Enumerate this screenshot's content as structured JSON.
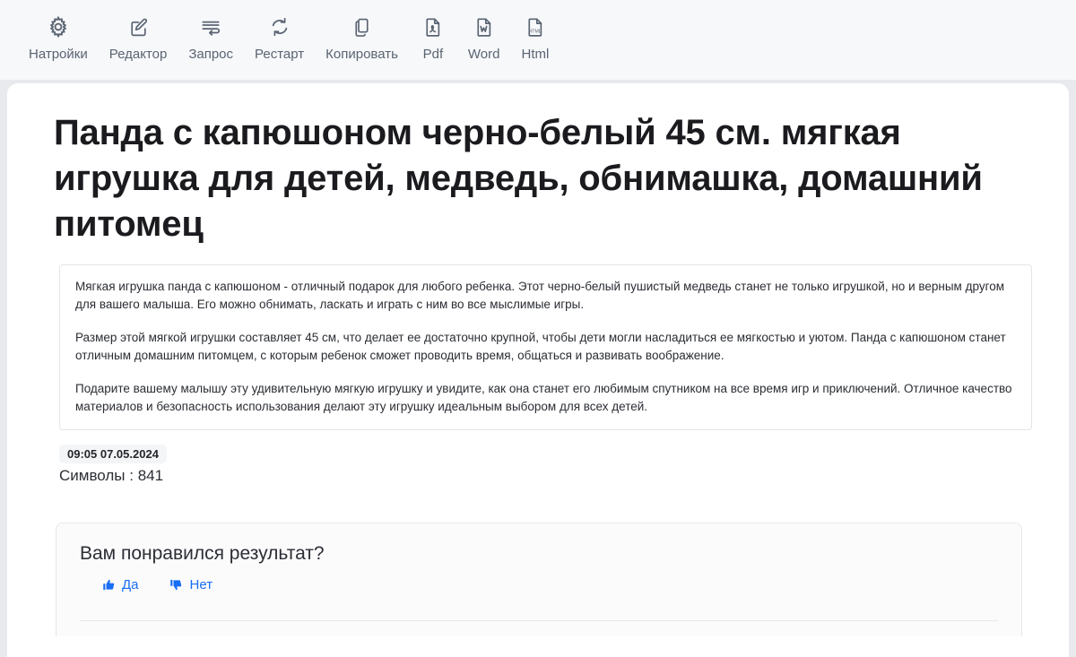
{
  "toolbar": {
    "items": [
      {
        "label": "Натройки",
        "icon": "gear-icon"
      },
      {
        "label": "Редактор",
        "icon": "pencil-edit-icon"
      },
      {
        "label": "Запрос",
        "icon": "request-lines-icon"
      },
      {
        "label": "Рестарт",
        "icon": "refresh-circular-icon"
      },
      {
        "label": "Копировать",
        "icon": "copy-icon"
      },
      {
        "label": "Pdf",
        "icon": "pdf-file-icon"
      },
      {
        "label": "Word",
        "icon": "word-file-icon"
      },
      {
        "label": "Html",
        "icon": "html-file-icon"
      }
    ]
  },
  "content": {
    "title": "Панда с капюшоном черно-белый 45 см. мягкая игрушка для детей, медведь, обнимашка, домашний питомец",
    "paragraphs": [
      "Мягкая игрушка панда с капюшоном - отличный подарок для любого ребенка. Этот черно-белый пушистый медведь станет не только игрушкой, но и верным другом для вашего малыша. Его можно обнимать, ласкать и играть с ним во все мыслимые игры.",
      "Размер этой мягкой игрушки составляет 45 см, что делает ее достаточно крупной, чтобы дети могли насладиться ее мягкостью и уютом. Панда с капюшоном станет отличным домашним питомцем, с которым ребенок сможет проводить время, общаться и развивать воображение.",
      "Подарите вашему малышу эту удивительную мягкую игрушку и увидите, как она станет его любимым спутником на все время игр и приключений. Отличное качество материалов и безопасность использования делают эту игрушку идеальным выбором для всех детей."
    ]
  },
  "meta": {
    "timestamp": "09:05 07.05.2024",
    "char_count_label": "Символы : 841"
  },
  "feedback": {
    "question": "Вам понравился результат?",
    "yes_label": "Да",
    "no_label": "Нет",
    "accent_color": "#1a6ef5"
  },
  "colors": {
    "page_background": "#e8eaed",
    "toolbar_background": "#f7f8fa",
    "card_background": "#ffffff",
    "icon_color": "#5a6472",
    "title_color": "#1b1b1f"
  }
}
